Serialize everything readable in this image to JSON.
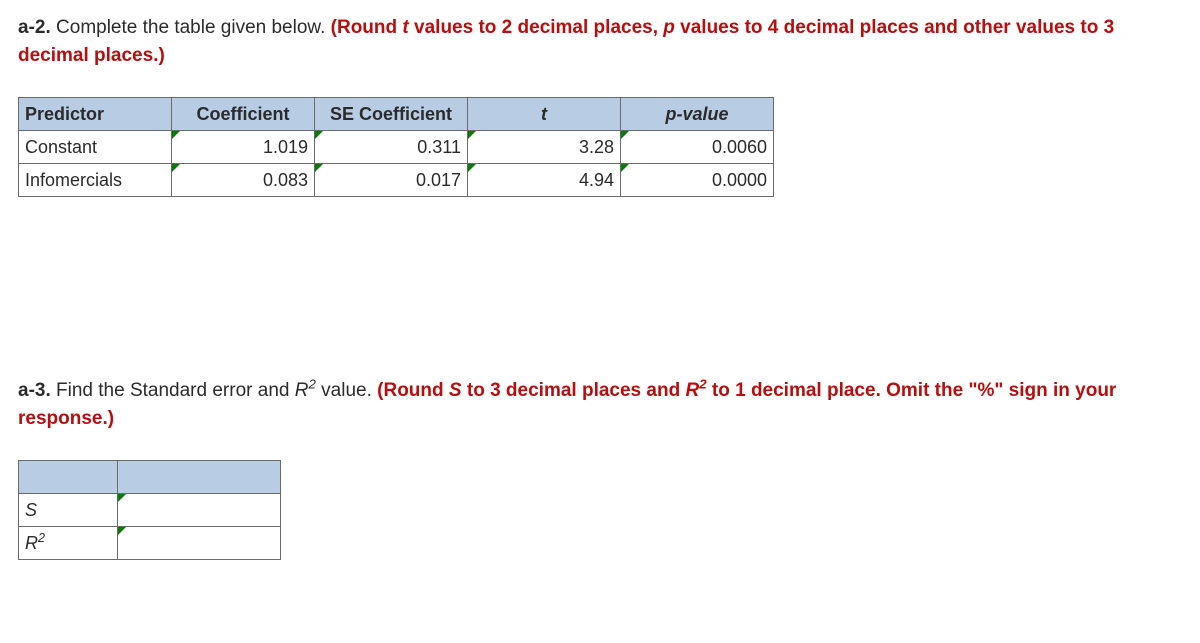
{
  "a2": {
    "label": "a-2.",
    "text": " Complete the table given below. ",
    "hint_pre": "(Round ",
    "hint_t": "t",
    "hint_mid1": " values to 2 decimal places, ",
    "hint_p": "p",
    "hint_mid2": " values to 4 decimal places and other values to 3 decimal places.)"
  },
  "table1": {
    "headers": {
      "predictor": "Predictor",
      "coef": "Coefficient",
      "se": "SE Coefficient",
      "t": "t",
      "p": "p-value"
    },
    "rows": [
      {
        "label": "Constant",
        "coef": "1.019",
        "se": "0.311",
        "t": "3.28",
        "p": "0.0060"
      },
      {
        "label": "Infomercials",
        "coef": "0.083",
        "se": "0.017",
        "t": "4.94",
        "p": "0.0000"
      }
    ]
  },
  "a3": {
    "label": "a-3.",
    "text1": " Find the Standard error and ",
    "r2": "R",
    "text2": " value. ",
    "hint_pre": "(Round ",
    "hint_s": "S",
    "hint_mid1": " to 3 decimal places and ",
    "hint_r": "R",
    "hint_mid2": " to 1 decimal place. Omit the \"%\" sign in your response.)"
  },
  "table2": {
    "rows": [
      {
        "label": "S",
        "value": ""
      },
      {
        "label": "R2",
        "value": ""
      }
    ]
  }
}
